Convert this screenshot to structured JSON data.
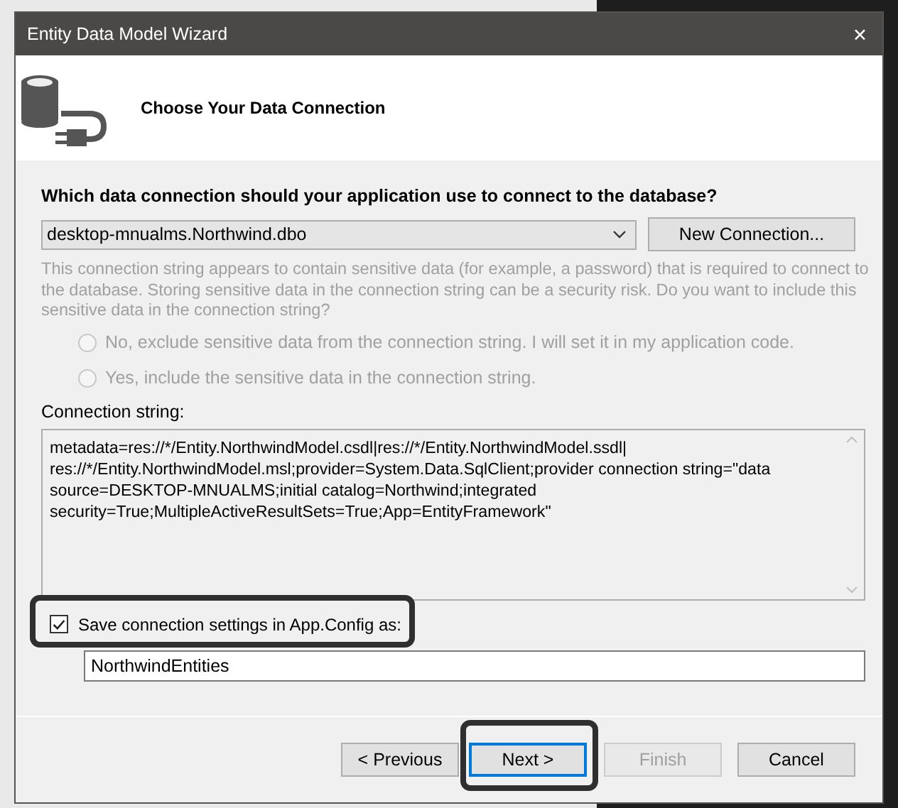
{
  "window": {
    "title": "Entity Data Model Wizard",
    "close": "✕"
  },
  "header": {
    "title": "Choose Your Data Connection"
  },
  "question": "Which data connection should your application use to connect to the database?",
  "connection_select": {
    "value": "desktop-mnualms.Northwind.dbo"
  },
  "new_connection_button": {
    "label": "New Connection..."
  },
  "sensitive_data": {
    "disabled": true,
    "note": "This connection string appears to contain sensitive data (for example, a password) that is required to connect to the database. Storing sensitive data in the connection string can be a security risk. Do you want to include this sensitive data in the connection string?",
    "options": [
      {
        "label": "No, exclude sensitive data from the connection string. I will set it in my application code.",
        "selected": false
      },
      {
        "label": "Yes, include the sensitive data in the connection string.",
        "selected": false
      }
    ]
  },
  "connection_string": {
    "label": "Connection string:",
    "lines": [
      "metadata=res://*/Entity.NorthwindModel.csdl|res://*/Entity.NorthwindModel.ssdl|",
      "res://*/Entity.NorthwindModel.msl;provider=System.Data.SqlClient;provider connection string=\"data",
      "source=DESKTOP-MNUALMS;initial catalog=Northwind;integrated",
      "security=True;MultipleActiveResultSets=True;App=EntityFramework\""
    ]
  },
  "save_settings": {
    "label": "Save connection settings in App.Config as:",
    "checked": true,
    "highlighted": true
  },
  "entity_name": {
    "value": "NorthwindEntities"
  },
  "buttons": [
    {
      "label": "< Previous",
      "disabled": false,
      "focused": false,
      "highlighted": false
    },
    {
      "label": "Next >",
      "disabled": false,
      "focused": true,
      "highlighted": true
    },
    {
      "label": "Finish",
      "disabled": true,
      "focused": false,
      "highlighted": false
    },
    {
      "label": "Cancel",
      "disabled": false,
      "focused": false,
      "highlighted": false
    }
  ]
}
